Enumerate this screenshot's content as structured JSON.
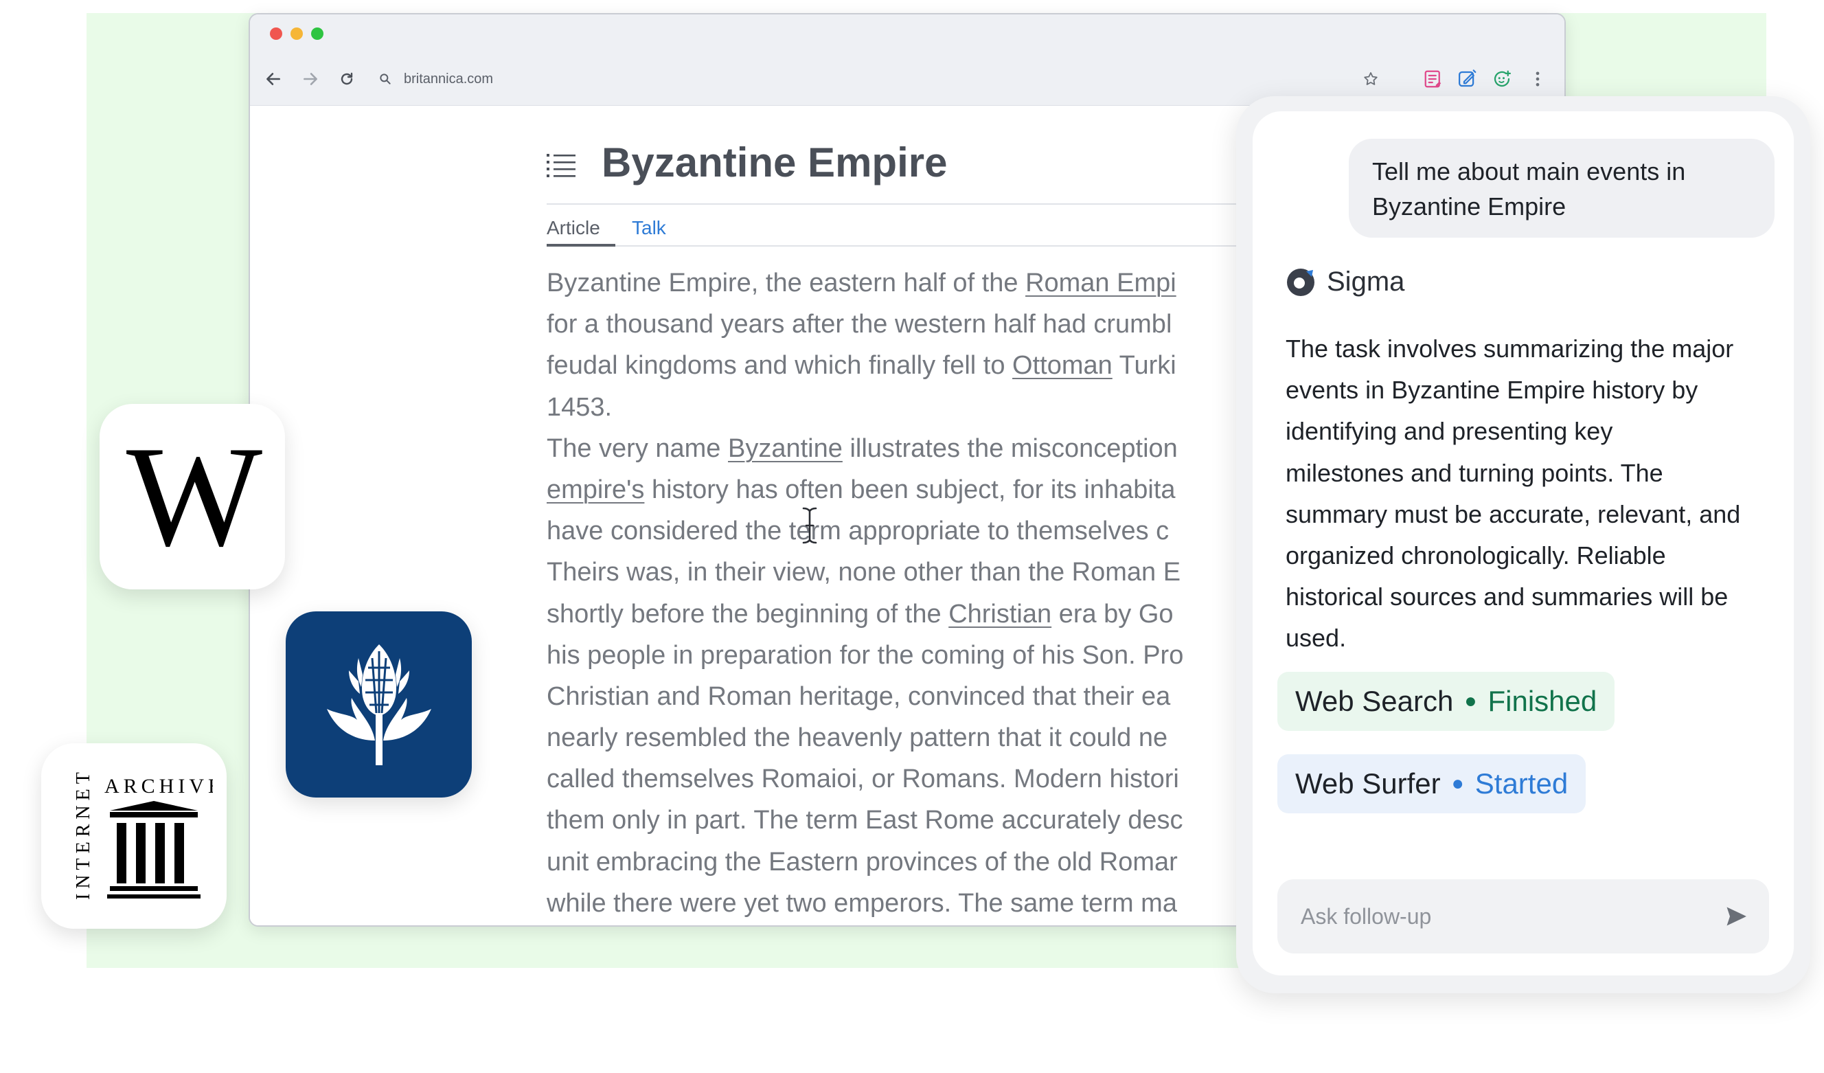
{
  "browser": {
    "url": "britannica.com",
    "toolbar_icons": [
      "back-arrow-icon",
      "forward-arrow-icon",
      "reload-icon",
      "search-icon",
      "star-icon",
      "note-extension-icon",
      "pen-extension-icon",
      "chat-extension-icon",
      "more-vert-icon"
    ]
  },
  "article": {
    "title": "Byzantine Empire",
    "tabs": [
      {
        "label": "Article",
        "active": true
      },
      {
        "label": "Talk",
        "active": false
      }
    ],
    "lines": [
      [
        {
          "t": "Byzantine Empire,  the eastern half of the "
        },
        {
          "t": "Roman Empi",
          "link": true
        }
      ],
      [
        {
          "t": "for a thousand years after the western half had crumbl"
        }
      ],
      [
        {
          "t": "feudal kingdoms and which finally fell to "
        },
        {
          "t": "Ottoman",
          "link": true
        },
        {
          "t": " Turki"
        }
      ],
      [
        {
          "t": "1453."
        }
      ],
      [
        {
          "t": "The very name "
        },
        {
          "t": "Byzantine",
          "link": true
        },
        {
          "t": " illustrates the misconception"
        }
      ],
      [
        {
          "t": "empire's",
          "link": true
        },
        {
          "t": " history has often been subject, for its inhabita"
        }
      ],
      [
        {
          "t": "have  considered the term appropriate to themselves c"
        }
      ],
      [
        {
          "t": "Theirs  was, in their view, none other than the Roman E"
        }
      ],
      [
        {
          "t": "shortly  before the beginning of the "
        },
        {
          "t": "Christian",
          "link": true
        },
        {
          "t": " era by Go"
        }
      ],
      [
        {
          "t": "his people in preparation for the coming of his Son. Pro"
        }
      ],
      [
        {
          "t": "Christian and Roman heritage, convinced that  their ea"
        }
      ],
      [
        {
          "t": "nearly resembled the heavenly pattern that it  could ne"
        }
      ],
      [
        {
          "t": "called themselves Romaioi, or Romans. Modern  histori"
        }
      ],
      [
        {
          "t": "them only in part. The term East Rome accurately  desc"
        }
      ],
      [
        {
          "t": "unit embracing the Eastern provinces of the old  Romar"
        }
      ],
      [
        {
          "t": "while there were yet two emperors. The same term ma"
        }
      ]
    ]
  },
  "apps": {
    "wikipedia": {
      "letter": "W",
      "icon": "wikipedia-icon"
    },
    "britannica": {
      "icon": "britannica-thistle-icon",
      "color": "#0d3f78"
    },
    "internet_archive": {
      "word_top": "ARCHIVE",
      "word_side": "INTERNET",
      "icon": "archive-building-icon"
    }
  },
  "assistant": {
    "user_message": "Tell me about main events in Byzantine Empire",
    "name": "Sigma",
    "answer": "The task involves summarizing the major\nevents in Byzantine Empire  history by\nidentifying and presenting key\nmilestones and turning points. The\nsummary must be accurate, relevant, and\norganized chronologically.  Reliable\nhistorical sources and summaries will be\nused.",
    "tools": [
      {
        "name": "Web Search",
        "status": "Finished",
        "color": "#11734b"
      },
      {
        "name": "Web Surfer",
        "status": "Started",
        "color": "#2e7bd6"
      }
    ],
    "followup_placeholder": "Ask follow-up",
    "followup_value": ""
  },
  "colors": {
    "background": "#e9fbe8",
    "link_blue": "#2e7bd6",
    "finished_green": "#11734b"
  }
}
